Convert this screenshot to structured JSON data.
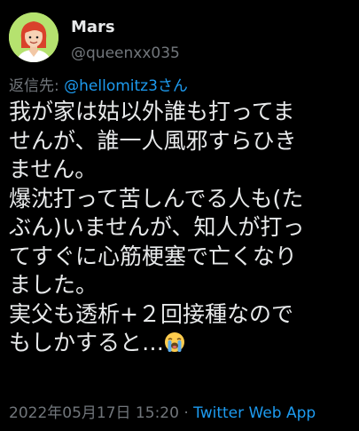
{
  "user": {
    "display_name": "Mars",
    "handle": "@queenxx035",
    "avatar_icon": "woman-avatar-icon"
  },
  "reply": {
    "prefix": "返信先: ",
    "mention": "@hellomitz3さん"
  },
  "tweet": {
    "lines": [
      "我が家は姑以外誰も打ってま",
      "せんが、誰一人風邪すらひき",
      "ません。",
      "爆沈打って苦しんでる人も(た",
      "ぶん)いませんが、知人が打っ",
      "てすぐに心筋梗塞で亡くなり",
      "ました。",
      "実父も透析+２回接種なので",
      "もしかすると…"
    ],
    "emoji_icon": "loudly-crying-face-icon"
  },
  "footer": {
    "timestamp": "2022年05月17日 15:20",
    "separator": " · ",
    "source": "Twitter Web App"
  },
  "colors": {
    "background": "#000000",
    "text": "#e7e9ea",
    "muted": "#71767b",
    "link": "#1d9bf0",
    "avatar_bg": "#b5e26f"
  }
}
